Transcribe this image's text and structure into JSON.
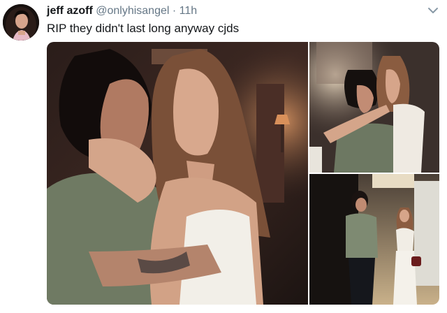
{
  "tweet": {
    "display_name": "jeff azoff",
    "handle": "@onlyhisangel",
    "separator": "·",
    "time": "11h",
    "text": "RIP they didn't last long anyway cjds"
  },
  "icons": {
    "menu": "chevron-down-icon"
  },
  "colors": {
    "name": "#14171a",
    "muted": "#657786"
  },
  "media": {
    "photo_count": 3
  }
}
